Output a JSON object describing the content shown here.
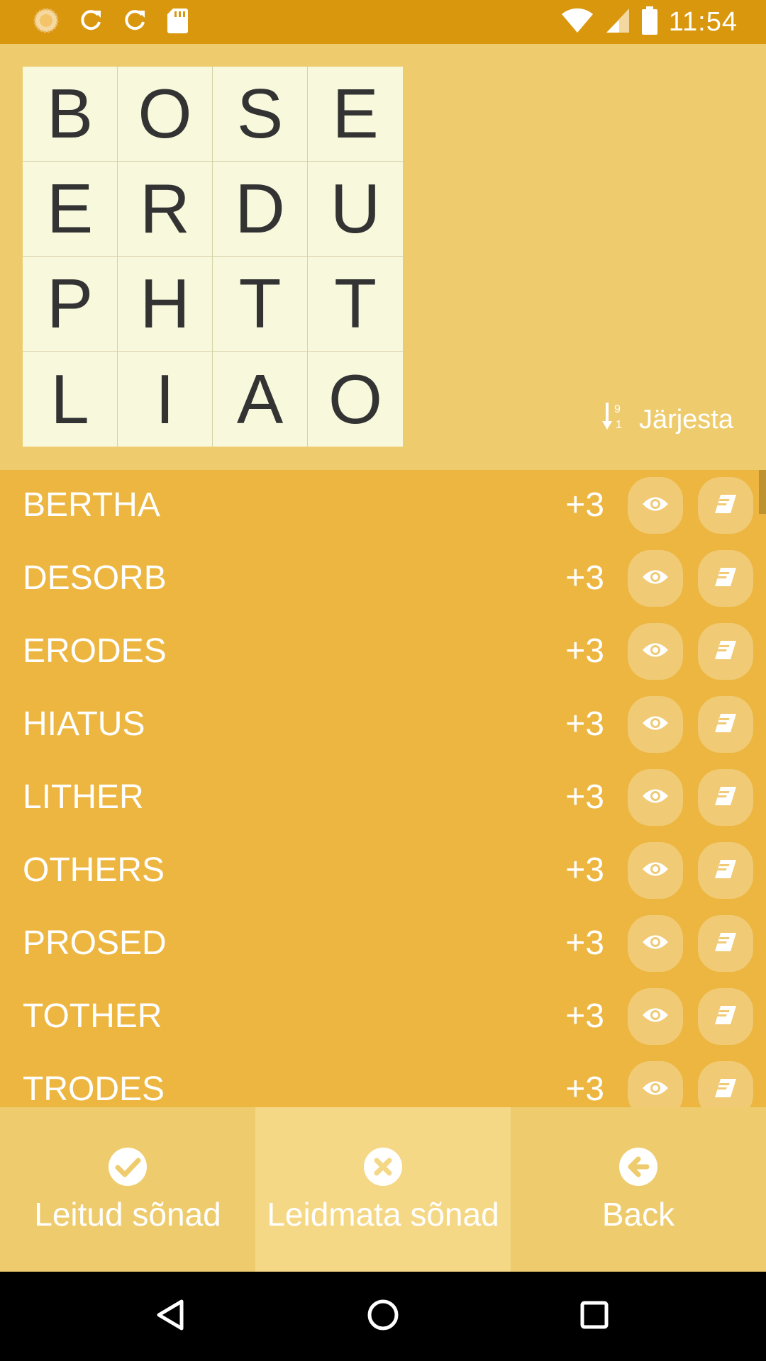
{
  "status_bar": {
    "time": "11:54",
    "left_icons": [
      "sun-icon",
      "refresh-icon",
      "refresh-icon",
      "sd-card-icon"
    ],
    "right_icons": [
      "wifi-icon",
      "signal-icon",
      "battery-icon"
    ]
  },
  "board": {
    "rows": [
      [
        "B",
        "O",
        "S",
        "E"
      ],
      [
        "E",
        "R",
        "D",
        "U"
      ],
      [
        "P",
        "H",
        "T",
        "T"
      ],
      [
        "L",
        "I",
        "A",
        "O"
      ]
    ]
  },
  "sort": {
    "label": "Järjesta",
    "icon": "sort-numeric-icon"
  },
  "words": [
    {
      "word": "BERTHA",
      "points": "+3"
    },
    {
      "word": "DESORB",
      "points": "+3"
    },
    {
      "word": "ERODES",
      "points": "+3"
    },
    {
      "word": "HIATUS",
      "points": "+3"
    },
    {
      "word": "LITHER",
      "points": "+3"
    },
    {
      "word": "OTHERS",
      "points": "+3"
    },
    {
      "word": "PROSED",
      "points": "+3"
    },
    {
      "word": "TOTHER",
      "points": "+3"
    },
    {
      "word": "TRODES",
      "points": "+3"
    }
  ],
  "word_actions": {
    "view_icon": "eye-icon",
    "book_icon": "book-icon"
  },
  "tabs": [
    {
      "label": "Leitud sõnad",
      "icon": "check-circle-icon",
      "active": false
    },
    {
      "label": "Leidmata sõnad",
      "icon": "x-circle-icon",
      "active": true
    },
    {
      "label": "Back",
      "icon": "back-arrow-circle-icon",
      "active": false
    }
  ],
  "nav_bar": {
    "icons": [
      "back-triangle-icon",
      "home-circle-icon",
      "recents-square-icon"
    ]
  },
  "colors": {
    "status_bar": "#D9970E",
    "board_bg": "#EECC6E",
    "grid_bg": "#F8F8DC",
    "list_bg": "#ECB640",
    "button_bg": "#F0CA74",
    "active_tab": "#F5D886"
  }
}
